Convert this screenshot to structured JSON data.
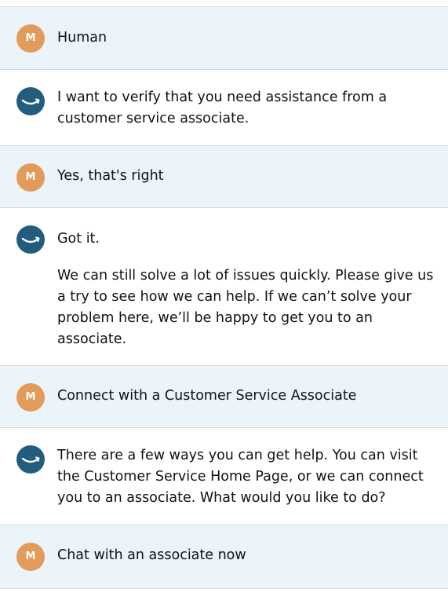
{
  "user_avatar_initial": "M",
  "colors": {
    "user_bg": "#eaf4f9",
    "bot_bg": "#ffffff",
    "user_avatar": "#e39b5b",
    "bot_avatar": "#235d7e",
    "divider": "#d5dbdb"
  },
  "messages": [
    {
      "sender": "user",
      "text": "Human"
    },
    {
      "sender": "bot",
      "paragraphs": [
        "I want to verify that you need assistance from a customer service associate."
      ]
    },
    {
      "sender": "user",
      "text": "Yes, that's right"
    },
    {
      "sender": "bot",
      "paragraphs": [
        "Got it.",
        "We can still solve a lot of issues quickly. Please give us a try to see how we can help. If we can’t solve your problem here, we’ll be happy to get you to an associate."
      ]
    },
    {
      "sender": "user",
      "text": "Connect with a Customer Service Associate"
    },
    {
      "sender": "bot",
      "paragraphs": [
        "There are a few ways you can get help. You can visit the Customer Service Home Page, or we can connect you to an associate. What would you like to do?"
      ]
    },
    {
      "sender": "user",
      "text": "Chat with an associate now"
    }
  ]
}
